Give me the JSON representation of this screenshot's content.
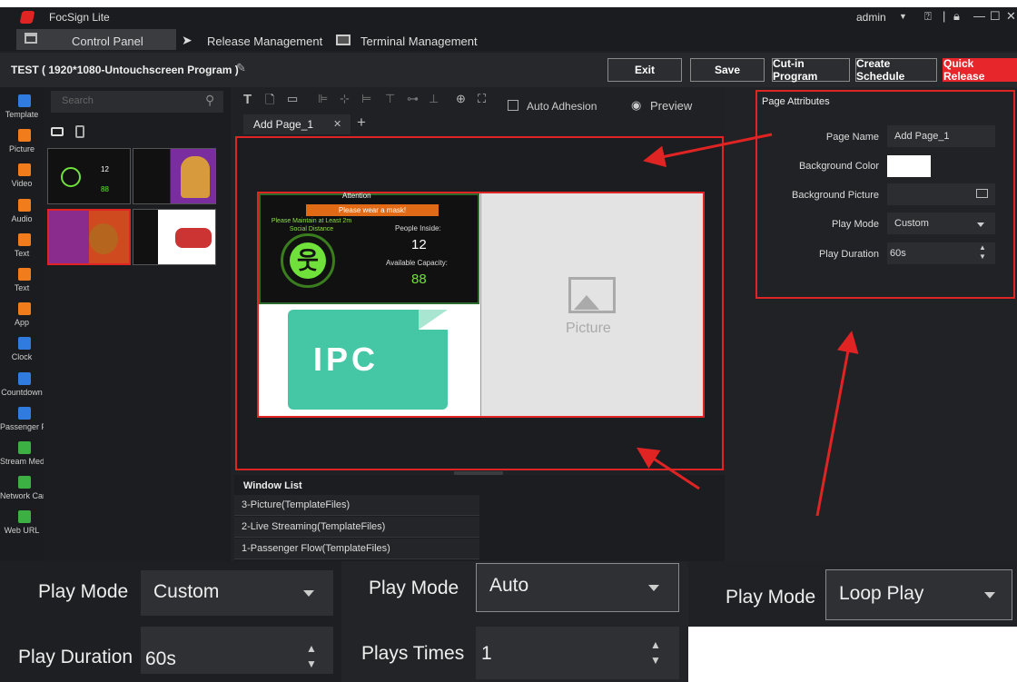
{
  "app": {
    "title": "FocSign Lite",
    "user": "admin"
  },
  "menu": {
    "control_panel": "Control Panel",
    "release": "Release Management",
    "terminal": "Terminal Management"
  },
  "program": {
    "title": "TEST ( 1920*1080-Untouchscreen Program )"
  },
  "actions": {
    "exit": "Exit",
    "save": "Save",
    "cutin": "Cut-in Program",
    "schedule": "Create Schedule",
    "quick": "Quick Release"
  },
  "nav": [
    {
      "label": "Template",
      "color": "#2f7be0"
    },
    {
      "label": "Picture",
      "color": "#f07c1c"
    },
    {
      "label": "Video",
      "color": "#f07c1c"
    },
    {
      "label": "Audio",
      "color": "#f07c1c"
    },
    {
      "label": "Text",
      "color": "#f07c1c"
    },
    {
      "label": "Text",
      "color": "#f07c1c"
    },
    {
      "label": "App",
      "color": "#f07c1c"
    },
    {
      "label": "Clock",
      "color": "#2f7be0"
    },
    {
      "label": "Countdown",
      "color": "#2f7be0"
    },
    {
      "label": "Passenger Fl",
      "color": "#2f7be0"
    },
    {
      "label": "Stream Med",
      "color": "#3cb043"
    },
    {
      "label": "Network Camer",
      "color": "#3cb043"
    },
    {
      "label": "Web URL",
      "color": "#3cb043"
    }
  ],
  "search": {
    "placeholder": "Search"
  },
  "toolbar": {
    "auto_adhesion": "Auto Adhesion",
    "preview": "Preview"
  },
  "tabs": {
    "page": "Add Page_1"
  },
  "canvas": {
    "attention": "Attention",
    "mask": "Please wear a mask!",
    "distance": "Please Maintain at Least 2m Social Distance",
    "people_inside_label": "People Inside:",
    "people_inside": "12",
    "capacity_label": "Available Capacity:",
    "capacity": "88",
    "ipc": "IPC",
    "picture": "Picture"
  },
  "window_list": {
    "title": "Window List",
    "items": [
      "3-Picture(TemplateFiles)",
      "2-Live Streaming(TemplateFiles)",
      "1-Passenger Flow(TemplateFiles)"
    ]
  },
  "attributes": {
    "title": "Page Attributes",
    "page_name_label": "Page Name",
    "page_name": "Add Page_1",
    "bg_color_label": "Background Color",
    "bg_picture_label": "Background Picture",
    "play_mode_label": "Play Mode",
    "play_mode": "Custom",
    "duration_label": "Play Duration",
    "duration": "60s"
  },
  "examples": {
    "a_mode_label": "Play Mode",
    "a_mode": "Custom",
    "a_duration_label": "Play Duration",
    "a_duration": "60s",
    "b_mode_label": "Play Mode",
    "b_mode": "Auto",
    "b_times_label": "Plays Times",
    "b_times": "1",
    "c_mode_label": "Play Mode",
    "c_mode": "Loop Play"
  }
}
